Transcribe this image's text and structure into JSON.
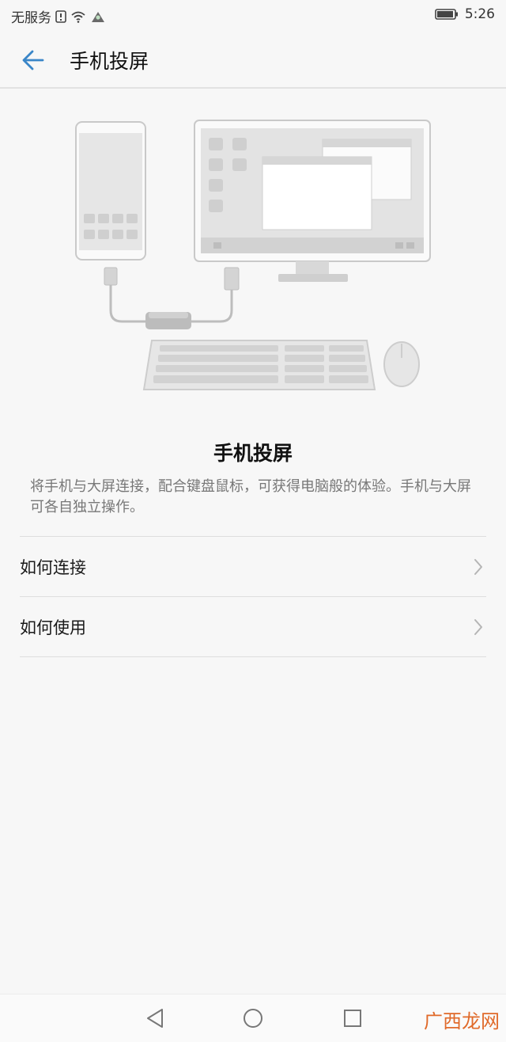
{
  "status_bar": {
    "carrier": "无服务",
    "time": "5:26",
    "icons": [
      "alert-icon",
      "wifi-icon",
      "vpn-icon",
      "battery-icon"
    ]
  },
  "app_bar": {
    "back_icon": "back-arrow-icon",
    "title": "手机投屏"
  },
  "content": {
    "headline": "手机投屏",
    "description": "将手机与大屏连接，配合键盘鼠标，可获得电脑般的体验。手机与大屏可各自独立操作。"
  },
  "menu": {
    "items": [
      {
        "label": "如何连接",
        "icon": "chevron-right-icon"
      },
      {
        "label": "如何使用",
        "icon": "chevron-right-icon"
      }
    ]
  },
  "nav_bar": {
    "buttons": [
      "back-triangle-icon",
      "home-circle-icon",
      "recents-square-icon"
    ],
    "watermark": "广西龙网"
  },
  "colors": {
    "accent": "#3a86c8",
    "background": "#f7f7f7",
    "divider": "#dedede",
    "watermark": "#e06a2a"
  }
}
